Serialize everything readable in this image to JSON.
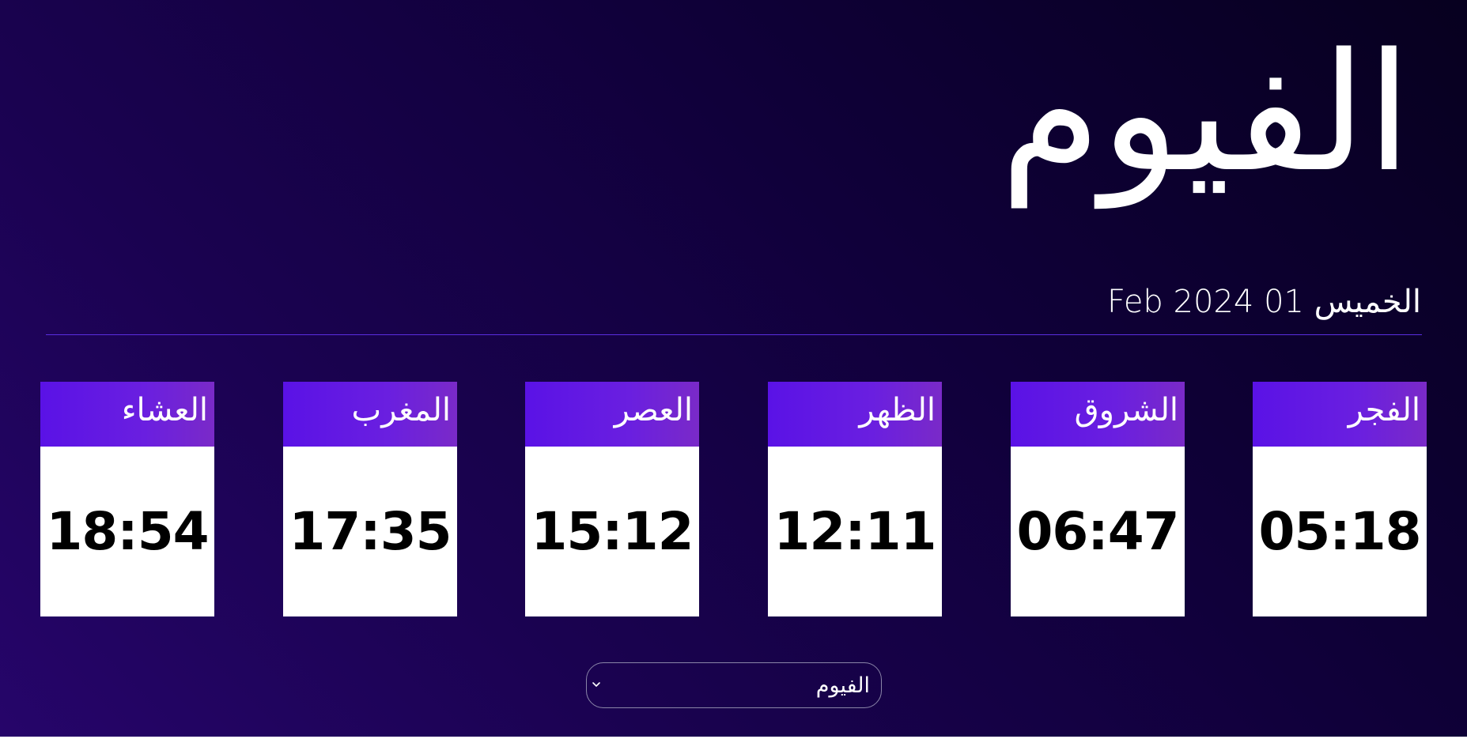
{
  "city": {
    "name": "الفيوم"
  },
  "date": {
    "text": "الخميس 01 Feb 2024"
  },
  "prayers": [
    {
      "name": "العشاء",
      "time": "18:54"
    },
    {
      "name": "المغرب",
      "time": "17:35"
    },
    {
      "name": "العصر",
      "time": "15:12"
    },
    {
      "name": "الظهر",
      "time": "12:11"
    },
    {
      "name": "الشروق",
      "time": "06:47"
    },
    {
      "name": "الفجر",
      "time": "05:18"
    }
  ],
  "city_select": {
    "selected": "الفيوم",
    "icon": "chevron-down-icon"
  },
  "colors": {
    "background_dark": "#07001f",
    "background_light": "#26056a",
    "accent": "#5a12e6",
    "card_body": "#ffffff",
    "time_text": "#000000"
  }
}
